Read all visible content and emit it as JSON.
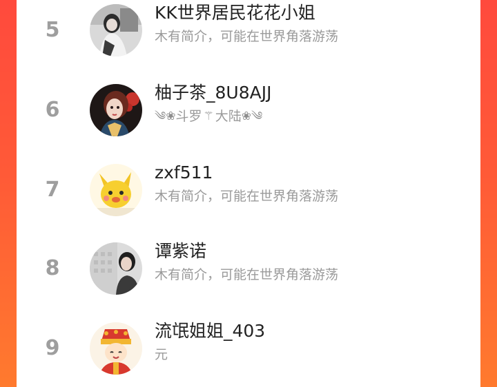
{
  "list": {
    "rows": [
      {
        "rank": "5",
        "name": "KK世界居民花花小姐",
        "bio": "木有简介，可能在世界角落游荡"
      },
      {
        "rank": "6",
        "name": "柚子茶_8U8AJJ",
        "bio_left": "斗罗",
        "bio_mid": "⚚",
        "bio_right": "大陆"
      },
      {
        "rank": "7",
        "name": "zxf511",
        "bio": "木有简介，可能在世界角落游荡"
      },
      {
        "rank": "8",
        "name": "谭紫诺",
        "bio": "木有简介，可能在世界角落游荡"
      },
      {
        "rank": "9",
        "name": "流氓姐姐_403",
        "bio": "元"
      }
    ]
  },
  "icons": {
    "row5": "user-avatar-photo-icon",
    "row6": "user-avatar-illustration-icon",
    "row7": "user-avatar-cartoon-icon",
    "row8": "user-avatar-photo-icon",
    "row9": "user-avatar-cartoon-icon"
  },
  "colors": {
    "background_gradient_top": "#ff4a3d",
    "background_gradient_bottom": "#ff7a2e",
    "rank_text": "#9e9e9e",
    "name_text": "#222222",
    "bio_text": "#9a9a9a"
  }
}
